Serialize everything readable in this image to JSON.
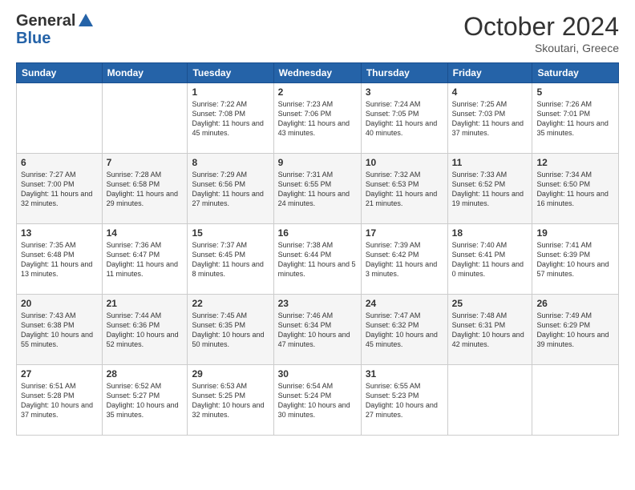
{
  "header": {
    "logo_line1": "General",
    "logo_line2": "Blue",
    "month": "October 2024",
    "location": "Skoutari, Greece"
  },
  "weekdays": [
    "Sunday",
    "Monday",
    "Tuesday",
    "Wednesday",
    "Thursday",
    "Friday",
    "Saturday"
  ],
  "weeks": [
    [
      {
        "day": "",
        "sunrise": "",
        "sunset": "",
        "daylight": ""
      },
      {
        "day": "",
        "sunrise": "",
        "sunset": "",
        "daylight": ""
      },
      {
        "day": "1",
        "sunrise": "Sunrise: 7:22 AM",
        "sunset": "Sunset: 7:08 PM",
        "daylight": "Daylight: 11 hours and 45 minutes."
      },
      {
        "day": "2",
        "sunrise": "Sunrise: 7:23 AM",
        "sunset": "Sunset: 7:06 PM",
        "daylight": "Daylight: 11 hours and 43 minutes."
      },
      {
        "day": "3",
        "sunrise": "Sunrise: 7:24 AM",
        "sunset": "Sunset: 7:05 PM",
        "daylight": "Daylight: 11 hours and 40 minutes."
      },
      {
        "day": "4",
        "sunrise": "Sunrise: 7:25 AM",
        "sunset": "Sunset: 7:03 PM",
        "daylight": "Daylight: 11 hours and 37 minutes."
      },
      {
        "day": "5",
        "sunrise": "Sunrise: 7:26 AM",
        "sunset": "Sunset: 7:01 PM",
        "daylight": "Daylight: 11 hours and 35 minutes."
      }
    ],
    [
      {
        "day": "6",
        "sunrise": "Sunrise: 7:27 AM",
        "sunset": "Sunset: 7:00 PM",
        "daylight": "Daylight: 11 hours and 32 minutes."
      },
      {
        "day": "7",
        "sunrise": "Sunrise: 7:28 AM",
        "sunset": "Sunset: 6:58 PM",
        "daylight": "Daylight: 11 hours and 29 minutes."
      },
      {
        "day": "8",
        "sunrise": "Sunrise: 7:29 AM",
        "sunset": "Sunset: 6:56 PM",
        "daylight": "Daylight: 11 hours and 27 minutes."
      },
      {
        "day": "9",
        "sunrise": "Sunrise: 7:31 AM",
        "sunset": "Sunset: 6:55 PM",
        "daylight": "Daylight: 11 hours and 24 minutes."
      },
      {
        "day": "10",
        "sunrise": "Sunrise: 7:32 AM",
        "sunset": "Sunset: 6:53 PM",
        "daylight": "Daylight: 11 hours and 21 minutes."
      },
      {
        "day": "11",
        "sunrise": "Sunrise: 7:33 AM",
        "sunset": "Sunset: 6:52 PM",
        "daylight": "Daylight: 11 hours and 19 minutes."
      },
      {
        "day": "12",
        "sunrise": "Sunrise: 7:34 AM",
        "sunset": "Sunset: 6:50 PM",
        "daylight": "Daylight: 11 hours and 16 minutes."
      }
    ],
    [
      {
        "day": "13",
        "sunrise": "Sunrise: 7:35 AM",
        "sunset": "Sunset: 6:48 PM",
        "daylight": "Daylight: 11 hours and 13 minutes."
      },
      {
        "day": "14",
        "sunrise": "Sunrise: 7:36 AM",
        "sunset": "Sunset: 6:47 PM",
        "daylight": "Daylight: 11 hours and 11 minutes."
      },
      {
        "day": "15",
        "sunrise": "Sunrise: 7:37 AM",
        "sunset": "Sunset: 6:45 PM",
        "daylight": "Daylight: 11 hours and 8 minutes."
      },
      {
        "day": "16",
        "sunrise": "Sunrise: 7:38 AM",
        "sunset": "Sunset: 6:44 PM",
        "daylight": "Daylight: 11 hours and 5 minutes."
      },
      {
        "day": "17",
        "sunrise": "Sunrise: 7:39 AM",
        "sunset": "Sunset: 6:42 PM",
        "daylight": "Daylight: 11 hours and 3 minutes."
      },
      {
        "day": "18",
        "sunrise": "Sunrise: 7:40 AM",
        "sunset": "Sunset: 6:41 PM",
        "daylight": "Daylight: 11 hours and 0 minutes."
      },
      {
        "day": "19",
        "sunrise": "Sunrise: 7:41 AM",
        "sunset": "Sunset: 6:39 PM",
        "daylight": "Daylight: 10 hours and 57 minutes."
      }
    ],
    [
      {
        "day": "20",
        "sunrise": "Sunrise: 7:43 AM",
        "sunset": "Sunset: 6:38 PM",
        "daylight": "Daylight: 10 hours and 55 minutes."
      },
      {
        "day": "21",
        "sunrise": "Sunrise: 7:44 AM",
        "sunset": "Sunset: 6:36 PM",
        "daylight": "Daylight: 10 hours and 52 minutes."
      },
      {
        "day": "22",
        "sunrise": "Sunrise: 7:45 AM",
        "sunset": "Sunset: 6:35 PM",
        "daylight": "Daylight: 10 hours and 50 minutes."
      },
      {
        "day": "23",
        "sunrise": "Sunrise: 7:46 AM",
        "sunset": "Sunset: 6:34 PM",
        "daylight": "Daylight: 10 hours and 47 minutes."
      },
      {
        "day": "24",
        "sunrise": "Sunrise: 7:47 AM",
        "sunset": "Sunset: 6:32 PM",
        "daylight": "Daylight: 10 hours and 45 minutes."
      },
      {
        "day": "25",
        "sunrise": "Sunrise: 7:48 AM",
        "sunset": "Sunset: 6:31 PM",
        "daylight": "Daylight: 10 hours and 42 minutes."
      },
      {
        "day": "26",
        "sunrise": "Sunrise: 7:49 AM",
        "sunset": "Sunset: 6:29 PM",
        "daylight": "Daylight: 10 hours and 39 minutes."
      }
    ],
    [
      {
        "day": "27",
        "sunrise": "Sunrise: 6:51 AM",
        "sunset": "Sunset: 5:28 PM",
        "daylight": "Daylight: 10 hours and 37 minutes."
      },
      {
        "day": "28",
        "sunrise": "Sunrise: 6:52 AM",
        "sunset": "Sunset: 5:27 PM",
        "daylight": "Daylight: 10 hours and 35 minutes."
      },
      {
        "day": "29",
        "sunrise": "Sunrise: 6:53 AM",
        "sunset": "Sunset: 5:25 PM",
        "daylight": "Daylight: 10 hours and 32 minutes."
      },
      {
        "day": "30",
        "sunrise": "Sunrise: 6:54 AM",
        "sunset": "Sunset: 5:24 PM",
        "daylight": "Daylight: 10 hours and 30 minutes."
      },
      {
        "day": "31",
        "sunrise": "Sunrise: 6:55 AM",
        "sunset": "Sunset: 5:23 PM",
        "daylight": "Daylight: 10 hours and 27 minutes."
      },
      {
        "day": "",
        "sunrise": "",
        "sunset": "",
        "daylight": ""
      },
      {
        "day": "",
        "sunrise": "",
        "sunset": "",
        "daylight": ""
      }
    ]
  ]
}
